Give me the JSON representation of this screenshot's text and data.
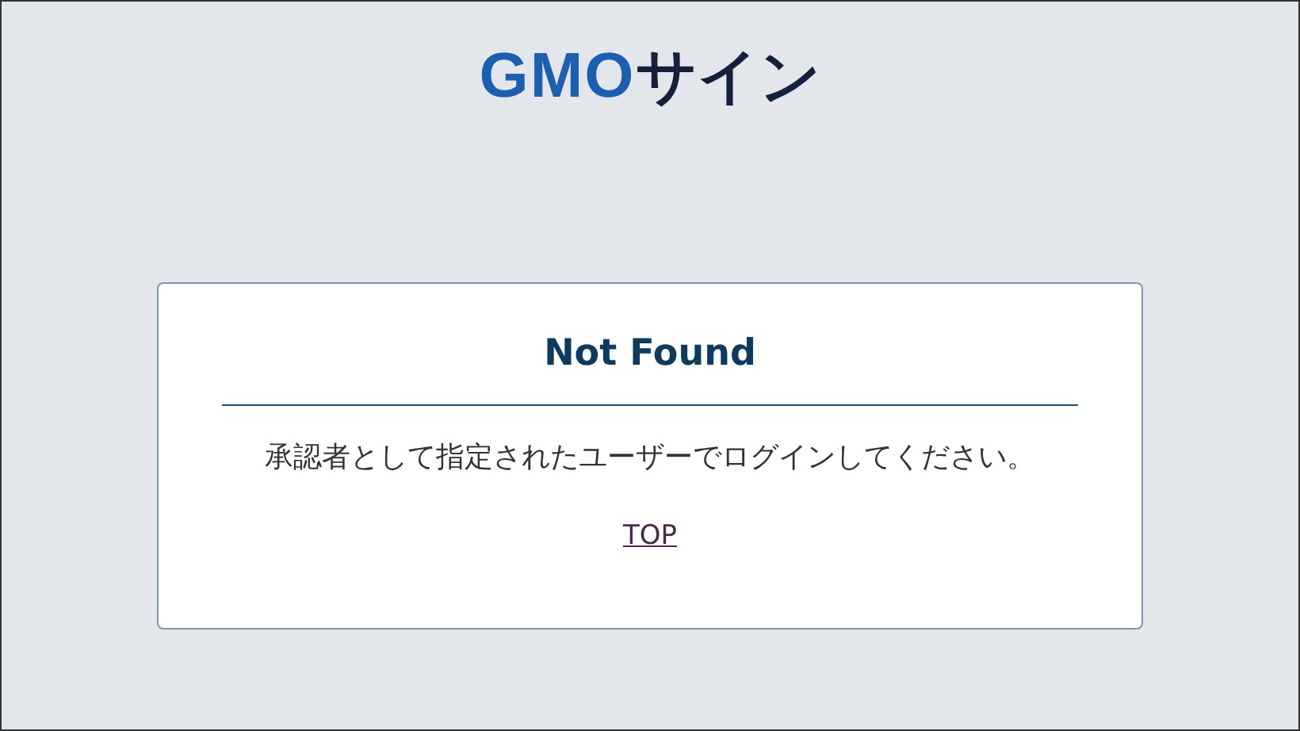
{
  "logo": {
    "brand": "GMO",
    "product": "サイン"
  },
  "card": {
    "title": "Not Found",
    "message": "承認者として指定されたユーザーでログインしてください。",
    "link": "TOP"
  }
}
